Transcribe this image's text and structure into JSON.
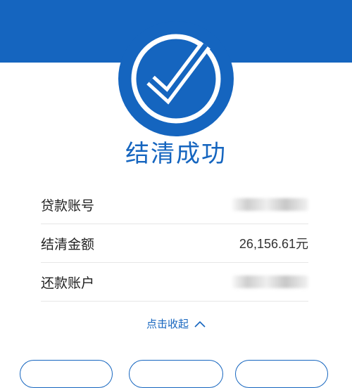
{
  "header": {
    "brand_color": "#1565bf"
  },
  "result": {
    "icon": "check-circle-icon",
    "title": "结清成功"
  },
  "details": [
    {
      "label": "贷款账号",
      "value": ""
    },
    {
      "label": "结清金额",
      "value": "26,156.61元"
    },
    {
      "label": "还款账户",
      "value": ""
    }
  ],
  "toggle": {
    "label": "点击收起",
    "icon": "chevron-up-icon"
  },
  "actions": [
    {
      "label": ""
    },
    {
      "label": ""
    },
    {
      "label": ""
    }
  ]
}
